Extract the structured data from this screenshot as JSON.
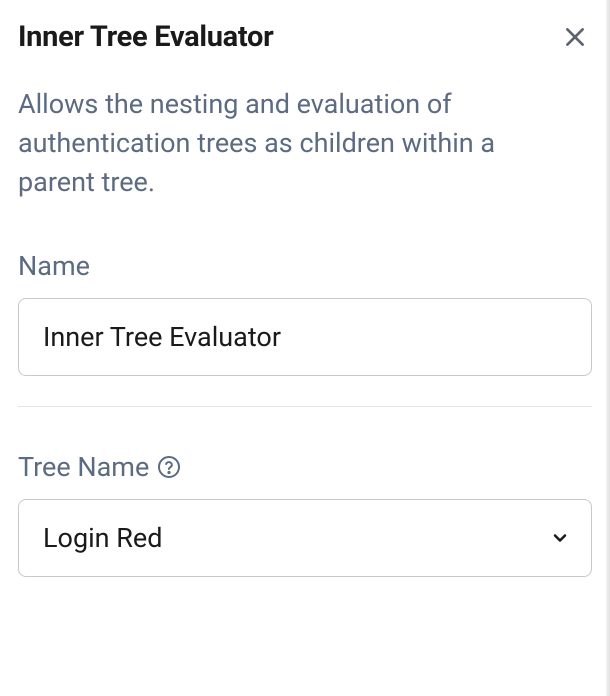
{
  "panel": {
    "title": "Inner Tree Evaluator",
    "description": "Allows the nesting and evaluation of authentication trees as children within a parent tree."
  },
  "fields": {
    "name": {
      "label": "Name",
      "value": "Inner Tree Evaluator"
    },
    "treeName": {
      "label": "Tree Name",
      "value": "Login Red"
    }
  }
}
